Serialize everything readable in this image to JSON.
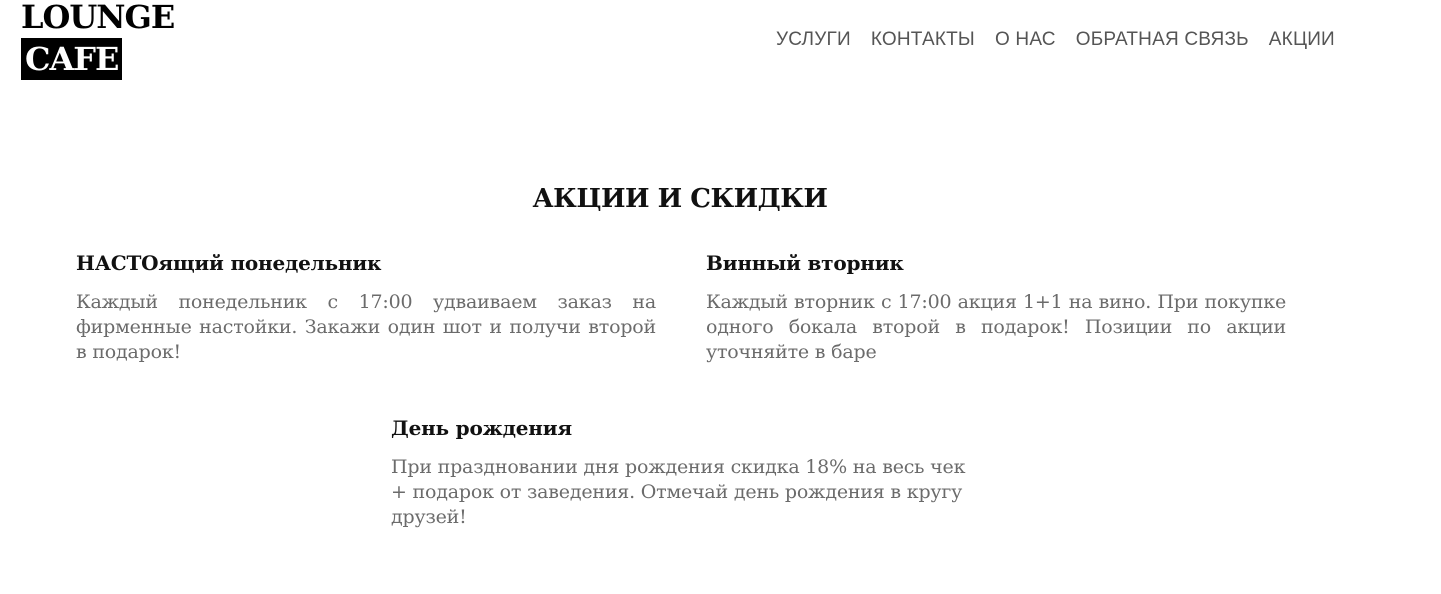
{
  "logo": {
    "line1": "LOUNGE",
    "line2": "CAFE"
  },
  "nav": {
    "items": [
      {
        "label": "УСЛУГИ"
      },
      {
        "label": "КОНТАКТЫ"
      },
      {
        "label": "О НАС"
      },
      {
        "label": "ОБРАТНАЯ СВЯЗЬ"
      },
      {
        "label": "АКЦИИ"
      }
    ]
  },
  "section": {
    "title": "АКЦИИ И СКИДКИ"
  },
  "promos": [
    {
      "title": "НАСТОящий понедельник",
      "text": "Каждый понедельник с 17:00 удваиваем заказ на фирменные настойки. Закажи один шот и получи второй в подарок!"
    },
    {
      "title": "Винный вторник",
      "text": "Каждый вторник с 17:00 акция 1+1 на вино. При покупке одного бокала второй в подарок! Позиции по акции уточняйте в баре"
    },
    {
      "title": "День рождения",
      "text": "При праздновании дня рождения скидка 18% на весь чек + подарок от заведения. Отмечай день рождения в кругу друзей!"
    }
  ],
  "colors": {
    "background": "#ffffff",
    "logo_bg": "#000000",
    "nav_text": "#555555",
    "body_text": "#6b6b6b"
  }
}
